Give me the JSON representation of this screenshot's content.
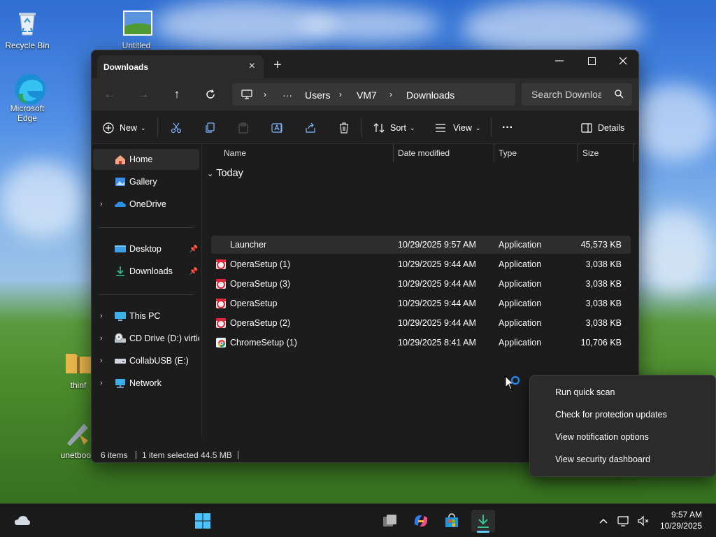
{
  "desktop": {
    "icons": [
      {
        "label": "Recycle Bin"
      },
      {
        "label": "Untitled"
      },
      {
        "label": "Microsoft Edge"
      },
      {
        "label": "thinf"
      },
      {
        "label": "unetboot"
      }
    ]
  },
  "window": {
    "tab_title": "Downloads",
    "new_tab_symbol": "+",
    "controls": {
      "minimize": "—",
      "maximize": "☐",
      "close": "✕"
    },
    "breadcrumb": [
      "Users",
      "VM7",
      "Downloads"
    ],
    "breadcrumb_overflow": "···",
    "search_placeholder": "Search Downloa",
    "toolbar": {
      "new_label": "New",
      "sort_label": "Sort",
      "view_label": "View",
      "more_label": "···",
      "details_label": "Details"
    },
    "sidebar": {
      "items": [
        {
          "label": "Home",
          "icon": "home-icon"
        },
        {
          "label": "Gallery",
          "icon": "gallery-icon"
        },
        {
          "label": "OneDrive",
          "icon": "onedrive-icon"
        },
        {
          "label": "Desktop",
          "icon": "desktop-folder-icon"
        },
        {
          "label": "Downloads",
          "icon": "downloads-folder-icon"
        },
        {
          "label": "This PC",
          "icon": "this-pc-icon"
        },
        {
          "label": "CD Drive (D:) virtio-",
          "icon": "cd-drive-icon"
        },
        {
          "label": "CollabUSB (E:)",
          "icon": "usb-drive-icon"
        },
        {
          "label": "Network",
          "icon": "network-icon"
        }
      ]
    },
    "columns": {
      "name": "Name",
      "date_modified": "Date modified",
      "type": "Type",
      "size": "Size"
    },
    "group_label": "Today",
    "files": [
      {
        "name": "Launcher",
        "date": "10/29/2025 9:57 AM",
        "type": "Application",
        "size": "45,573 KB",
        "icon": "app-icon",
        "selected": true
      },
      {
        "name": "OperaSetup (1)",
        "date": "10/29/2025 9:44 AM",
        "type": "Application",
        "size": "3,038 KB",
        "icon": "opera-installer-icon"
      },
      {
        "name": "OperaSetup (3)",
        "date": "10/29/2025 9:44 AM",
        "type": "Application",
        "size": "3,038 KB",
        "icon": "opera-installer-icon"
      },
      {
        "name": "OperaSetup",
        "date": "10/29/2025 9:44 AM",
        "type": "Application",
        "size": "3,038 KB",
        "icon": "opera-installer-icon"
      },
      {
        "name": "OperaSetup (2)",
        "date": "10/29/2025 9:44 AM",
        "type": "Application",
        "size": "3,038 KB",
        "icon": "opera-installer-icon"
      },
      {
        "name": "ChromeSetup (1)",
        "date": "10/29/2025 8:41 AM",
        "type": "Application",
        "size": "10,706 KB",
        "icon": "chrome-installer-icon"
      }
    ],
    "status": {
      "count": "6 items",
      "selection": "1 item selected  44.5 MB"
    }
  },
  "context_menu": {
    "items": [
      "Run quick scan",
      "Check for protection updates",
      "View notification options",
      "View security dashboard"
    ]
  },
  "taskbar": {
    "time": "9:57 AM",
    "date": "10/29/2025"
  },
  "colors": {
    "accent": "#60cdff",
    "window_bg": "#1c1c1c",
    "selection": "#2d2d2d"
  }
}
